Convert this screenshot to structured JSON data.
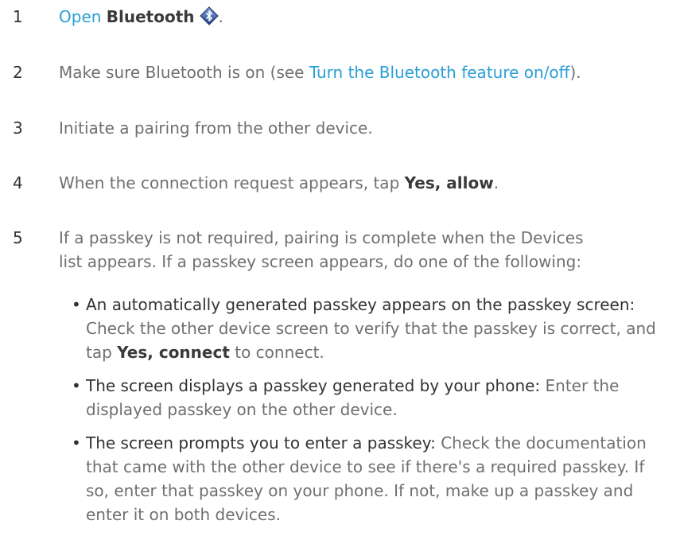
{
  "steps": [
    {
      "num": "1",
      "link": "Open",
      "bold": "Bluetooth",
      "tail": "."
    },
    {
      "num": "2",
      "pre": "Make sure Bluetooth is on (see ",
      "link": "Turn the Bluetooth feature on/off",
      "post": ")."
    },
    {
      "num": "3",
      "text": "Initiate a pairing from the other device."
    },
    {
      "num": "4",
      "pre": "When the connection request appears, tap ",
      "bold": "Yes, allow",
      "post": "."
    },
    {
      "num": "5",
      "text": "If a passkey is not required, pairing is complete when the Devices list appears. If a passkey screen appears, do one of the following:"
    }
  ],
  "bullets": [
    {
      "lead": "An automatically generated passkey appears on the passkey screen:",
      "pre": "Check the other device screen to verify that the passkey is correct, and tap ",
      "bold": "Yes, connect",
      "post": " to connect."
    },
    {
      "lead": "The screen displays a passkey generated by your phone:",
      "text": "Enter the displayed passkey on the other device."
    },
    {
      "lead": "The screen prompts you to enter a passkey:",
      "text": "Check the documentation that came with the other device to see if there's a required passkey. If so, enter that passkey on your phone. If not, make up a passkey and enter it on both devices."
    }
  ],
  "icons": {
    "bluetooth": "bluetooth-icon"
  },
  "colors": {
    "link": "#2a9fd6",
    "body": "#6f6f6f",
    "emphasis": "#3a3a3a"
  }
}
